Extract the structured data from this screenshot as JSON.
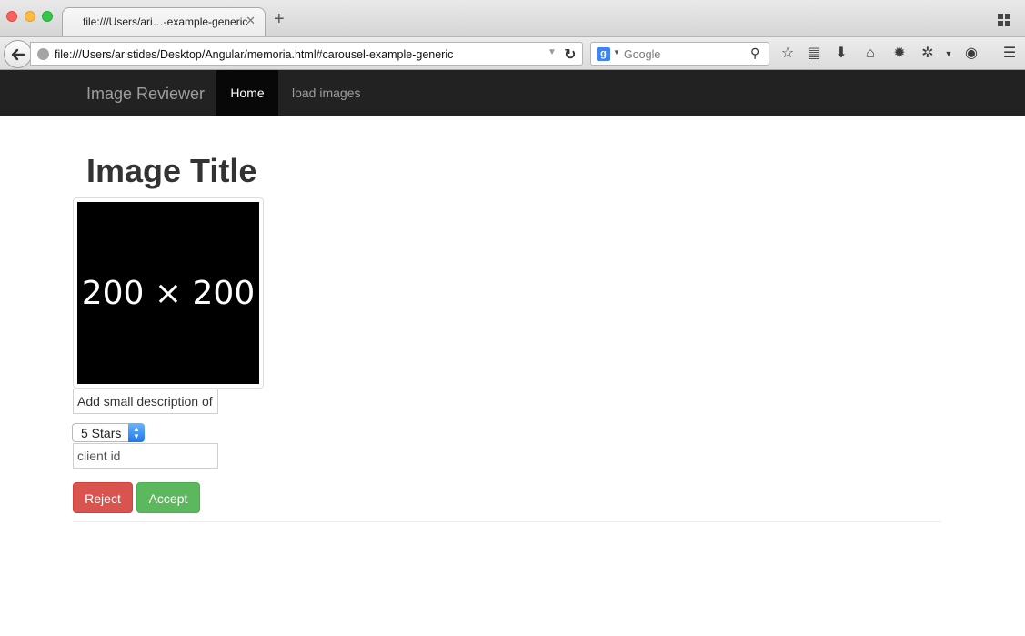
{
  "browser": {
    "tab_title": "file:///Users/ari…-example-generic",
    "tab_close": "✕",
    "new_tab": "+",
    "url": "file:///Users/aristides/Desktop/Angular/memoria.html#carousel-example-generic",
    "search_engine_letter": "g",
    "search_placeholder": "Google",
    "toolbar_icons": [
      "bookmark-star-icon",
      "reading-list-icon",
      "download-icon",
      "home-icon",
      "settings-icon",
      "extension-icon",
      "sync-icon",
      "menu-icon"
    ]
  },
  "navbar": {
    "brand": "Image Reviewer",
    "items": [
      {
        "label": "Home",
        "active": true
      },
      {
        "label": "load images",
        "active": false
      }
    ]
  },
  "main": {
    "title": "Image Title",
    "image_placeholder": "200 × 200",
    "description_value": "Add small description of",
    "rating_selected": "5 Stars",
    "client_id_placeholder": "client id",
    "reject_label": "Reject",
    "accept_label": "Accept"
  },
  "colors": {
    "navbar_bg": "#222222",
    "reject": "#d9534f",
    "accept": "#5cb85c"
  }
}
